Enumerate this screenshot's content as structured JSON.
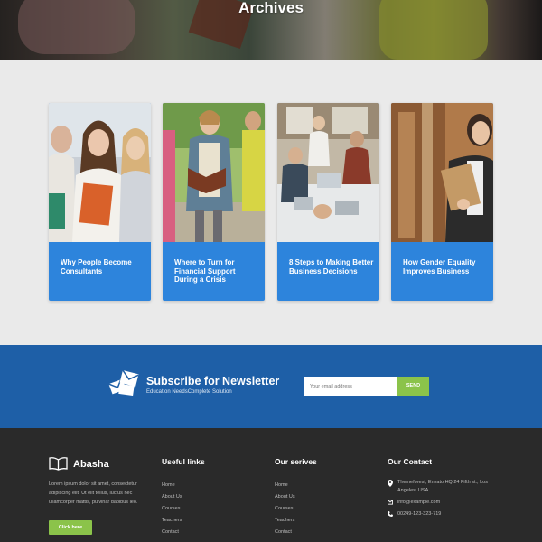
{
  "hero": {
    "title": "Archives"
  },
  "cards": [
    {
      "title": "Why People Become Consultants"
    },
    {
      "title": "Where to Turn for Financial Support During a Crisis"
    },
    {
      "title": "8 Steps to Making Better Business Decisions"
    },
    {
      "title": "How Gender Equality Improves Business"
    }
  ],
  "newsletter": {
    "title": "Subscribe for Newsletter",
    "subtitle": "Education NeedsComplete Solution",
    "placeholder": "Your email address",
    "send_label": "SEND",
    "icon": "newsletter-icon"
  },
  "footer": {
    "brand": {
      "name": "Abasha",
      "icon": "book-icon"
    },
    "about": "Lorem ipsum dolor sit amet, consectetur adipiscing elit. Ut elit tellus, luctus nec ullamcorper mattis, pulvinar dapibus leo.",
    "button_label": "Click here",
    "useful_links": {
      "title": "Useful links",
      "items": [
        "Home",
        "About Us",
        "Courses",
        "Teachers",
        "Contact"
      ]
    },
    "services": {
      "title": "Our serives",
      "items": [
        "Home",
        "About Us",
        "Courses",
        "Teachers",
        "Contact"
      ]
    },
    "contact": {
      "title": "Our Contact",
      "address": "Themeforest, Envato HQ 24 Fifth st., Los Angeles, USA",
      "email": "info@example.com",
      "phone": "00249-123-323-719"
    }
  },
  "colors": {
    "card_blue": "#2d84dc",
    "newsletter_blue": "#1e5fa7",
    "footer_dark": "#2a2a2a",
    "accent_green": "#8bc34a"
  }
}
